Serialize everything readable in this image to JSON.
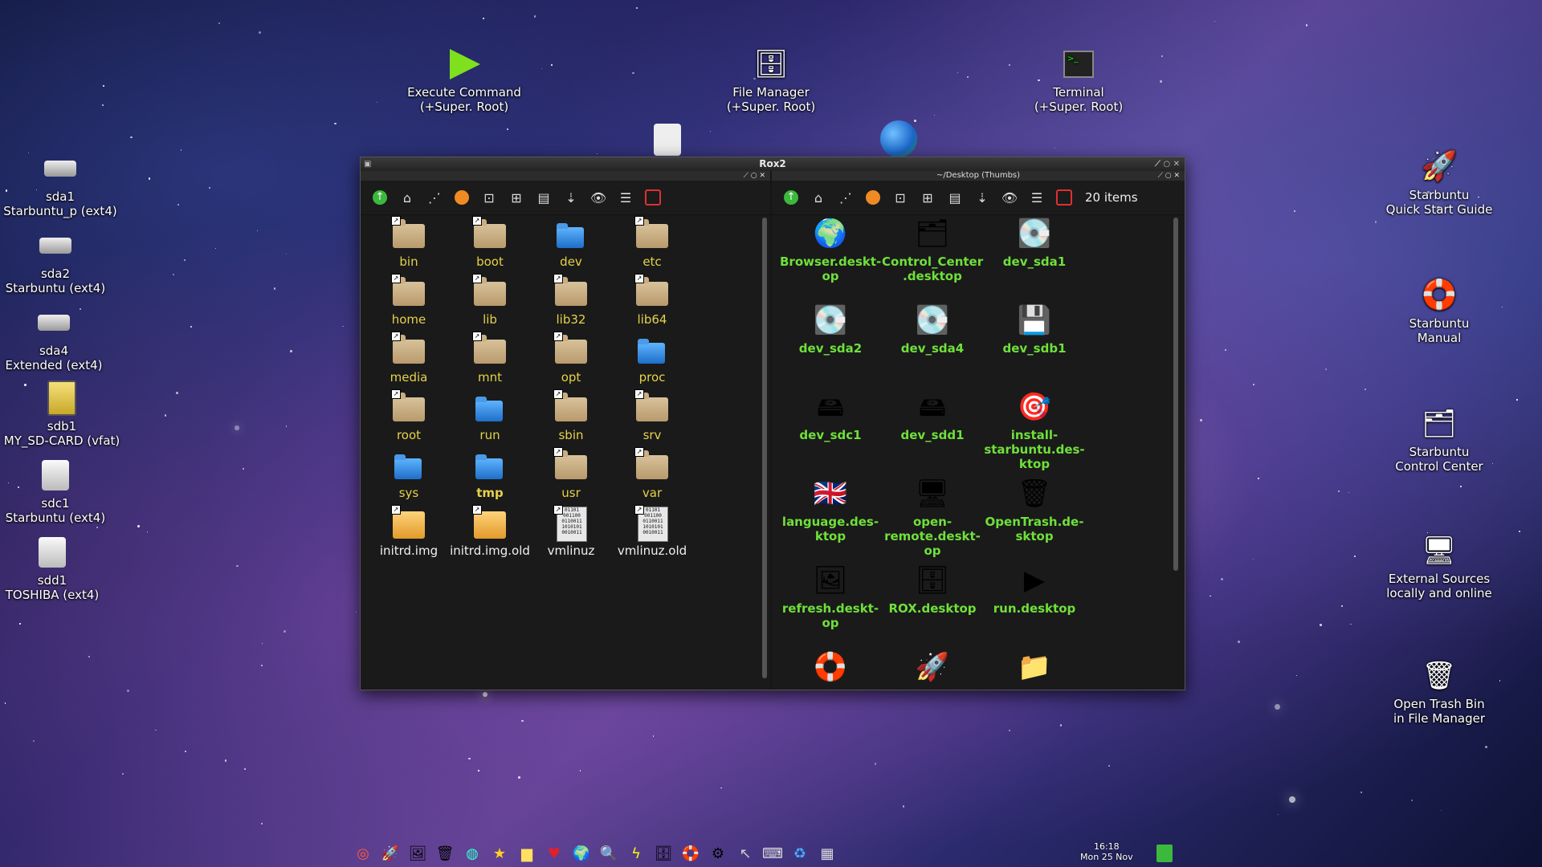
{
  "window": {
    "title": "Rox2",
    "left_pane": {
      "header": ""
    },
    "right_pane": {
      "header": "~/Desktop (Thumbs)",
      "items_count": "20 items"
    }
  },
  "desktop_icons": {
    "execute": {
      "line1": "Execute Command",
      "line2": "(+Super. Root)",
      "icon": "play-icon"
    },
    "filemanager": {
      "line1": "File Manager",
      "line2": "(+Super. Root)",
      "icon": "file-manager-icon"
    },
    "terminal": {
      "line1": "Terminal",
      "line2": "(+Super. Root)",
      "icon": "terminal-icon"
    },
    "sda1": {
      "line1": "sda1",
      "line2": "Starbuntu_p (ext4)"
    },
    "sda2": {
      "line1": "sda2",
      "line2": "Starbuntu (ext4)"
    },
    "sda4": {
      "line1": "sda4",
      "line2": "Extended (ext4)"
    },
    "sdb1": {
      "line1": "sdb1",
      "line2": "MY_SD-CARD (vfat)"
    },
    "sdc1": {
      "line1": "sdc1",
      "line2": "Starbuntu (ext4)"
    },
    "sdd1": {
      "line1": "sdd1",
      "line2": "TOSHIBA (ext4)"
    },
    "quickstart": {
      "line1": "Starbuntu",
      "line2": "Quick Start Guide"
    },
    "manual": {
      "line1": "Starbuntu",
      "line2": "Manual"
    },
    "control": {
      "line1": "Starbuntu",
      "line2": "Control Center"
    },
    "external": {
      "line1": "External Sources",
      "line2": "locally and online"
    },
    "trash": {
      "line1": "Open Trash Bin",
      "line2": "in File Manager"
    }
  },
  "left_items": [
    {
      "name": "bin",
      "type": "folder"
    },
    {
      "name": "boot",
      "type": "folder"
    },
    {
      "name": "dev",
      "type": "bfolder"
    },
    {
      "name": "etc",
      "type": "folder"
    },
    {
      "name": "home",
      "type": "folder"
    },
    {
      "name": "lib",
      "type": "folder"
    },
    {
      "name": "lib32",
      "type": "folder"
    },
    {
      "name": "lib64",
      "type": "folder"
    },
    {
      "name": "media",
      "type": "folder"
    },
    {
      "name": "mnt",
      "type": "folder"
    },
    {
      "name": "opt",
      "type": "folder"
    },
    {
      "name": "proc",
      "type": "bfolder"
    },
    {
      "name": "root",
      "type": "folder"
    },
    {
      "name": "run",
      "type": "bfolder"
    },
    {
      "name": "sbin",
      "type": "folder"
    },
    {
      "name": "srv",
      "type": "folder"
    },
    {
      "name": "sys",
      "type": "bfolder"
    },
    {
      "name": "tmp",
      "type": "bfolder"
    },
    {
      "name": "usr",
      "type": "folder"
    },
    {
      "name": "var",
      "type": "folder"
    },
    {
      "name": "initrd.img",
      "type": "ofolder"
    },
    {
      "name": "initrd.img.old",
      "type": "ofolder"
    },
    {
      "name": "vmlinuz",
      "type": "binary"
    },
    {
      "name": "vmlinuz.old",
      "type": "binary"
    }
  ],
  "right_items": [
    {
      "l1": "Browser.deskt-",
      "l2": "op",
      "l3": "",
      "icon": "🌍"
    },
    {
      "l1": "Control_Center",
      "l2": ".desktop",
      "l3": "",
      "icon": "🗂"
    },
    {
      "l1": "dev_sda1",
      "l2": "",
      "l3": "",
      "icon": "💽"
    },
    {
      "l1": "dev_sda2",
      "l2": "",
      "l3": "",
      "icon": "💽"
    },
    {
      "l1": "dev_sda4",
      "l2": "",
      "l3": "",
      "icon": "💽"
    },
    {
      "l1": "dev_sdb1",
      "l2": "",
      "l3": "",
      "icon": "💾"
    },
    {
      "l1": "dev_sdc1",
      "l2": "",
      "l3": "",
      "icon": "🖴"
    },
    {
      "l1": "dev_sdd1",
      "l2": "",
      "l3": "",
      "icon": "🖴"
    },
    {
      "l1": "install-",
      "l2": "starbuntu.des-",
      "l3": "ktop",
      "icon": "🎯"
    },
    {
      "l1": "language.des-",
      "l2": "ktop",
      "l3": "",
      "icon": "🇬🇧"
    },
    {
      "l1": "open-",
      "l2": "remote.deskt-",
      "l3": "op",
      "icon": "🖥"
    },
    {
      "l1": "OpenTrash.de-",
      "l2": "sktop",
      "l3": "",
      "icon": "🗑"
    },
    {
      "l1": "refresh.deskt-",
      "l2": "op",
      "l3": "",
      "icon": "🖼"
    },
    {
      "l1": "ROX.desktop",
      "l2": "",
      "l3": "",
      "icon": "🗄"
    },
    {
      "l1": "run.desktop",
      "l2": "",
      "l3": "",
      "icon": "▶"
    },
    {
      "l1": "",
      "l2": "",
      "l3": "",
      "icon": "🛟"
    },
    {
      "l1": "",
      "l2": "",
      "l3": "",
      "icon": "🚀"
    },
    {
      "l1": "",
      "l2": "",
      "l3": "",
      "icon": "📁"
    }
  ],
  "clock": {
    "time": "16:18",
    "date": "Mon 25 Nov"
  },
  "colors": {
    "folder_label": "#e5d24a",
    "desktop_label": "#6fe03a"
  }
}
